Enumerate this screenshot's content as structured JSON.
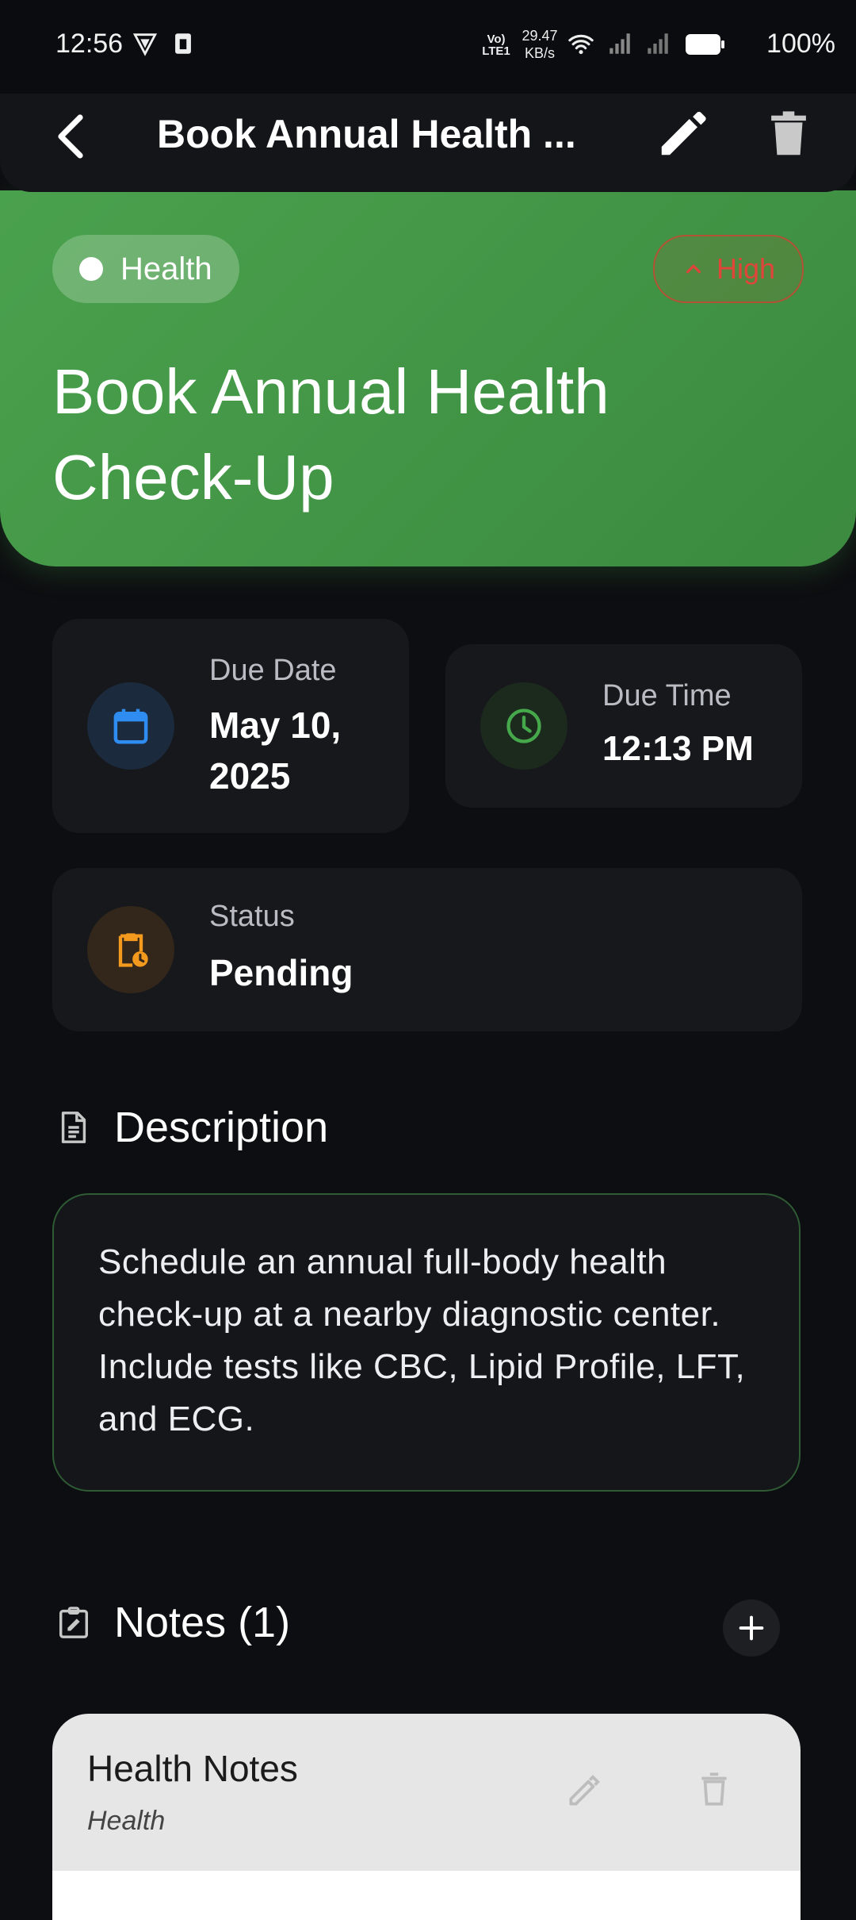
{
  "status_bar": {
    "time": "12:56",
    "network_speed_value": "29.47",
    "network_speed_unit": "KB/s",
    "battery": "100%",
    "lte_label": "Vo) LTE1"
  },
  "app_bar": {
    "title": "Book Annual Health ...",
    "icons": [
      "back-arrow-icon",
      "edit-icon",
      "trash-icon"
    ]
  },
  "task": {
    "category": "Health",
    "priority": "High",
    "title": "Book Annual Health Check-Up",
    "accent_color": "#43a047",
    "priority_color": "#e0453a"
  },
  "details": {
    "due_date_label": "Due Date",
    "due_date_value": "May 10, 2025",
    "due_time_label": "Due Time",
    "due_time_value": "12:13 PM",
    "status_label": "Status",
    "status_value": "Pending"
  },
  "description": {
    "heading": "Description",
    "text": "Schedule an annual full-body health check-up at a nearby diagnostic center. Include tests like CBC, Lipid Profile, LFT, and ECG."
  },
  "notes": {
    "heading": "Notes (1)",
    "items": [
      {
        "title": "Health Notes",
        "category": "Health"
      }
    ]
  }
}
